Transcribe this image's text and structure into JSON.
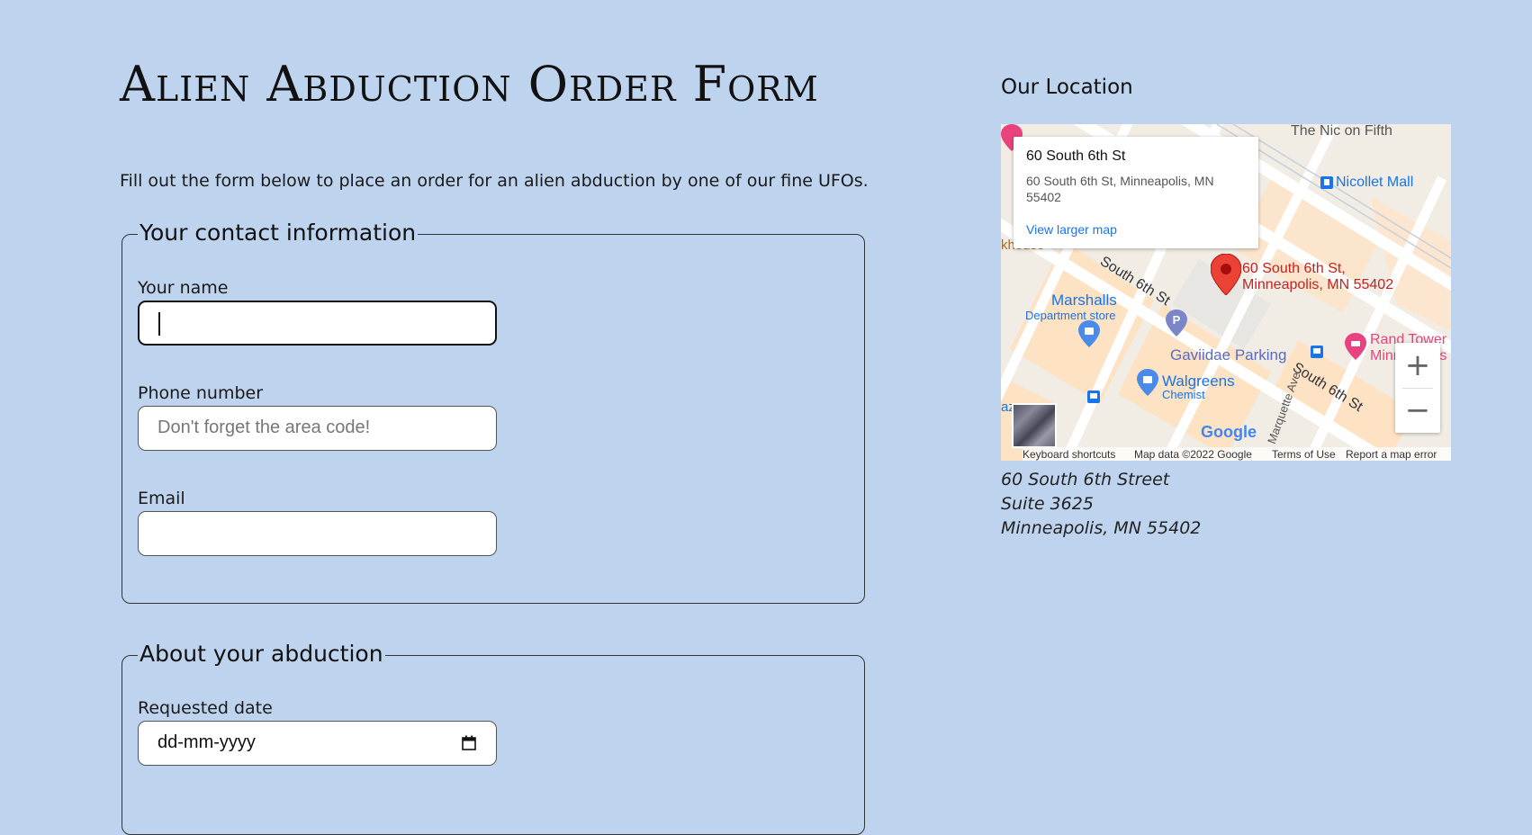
{
  "page": {
    "title": "Alien Abduction Order Form",
    "intro": "Fill out the form below to place an order for an alien abduction by one of our fine UFOs."
  },
  "contact": {
    "legend": "Your contact information",
    "name_label": "Your name",
    "name_value": "",
    "phone_label": "Phone number",
    "phone_placeholder": "Don't forget the area code!",
    "email_label": "Email",
    "email_value": ""
  },
  "abduction": {
    "legend": "About your abduction",
    "date_label": "Requested date",
    "date_placeholder": "dd-mm-yyyy"
  },
  "location": {
    "heading": "Our Location",
    "address_lines": [
      "60 South 6th Street",
      "Suite 3625",
      "Minneapolis, MN 55402"
    ]
  },
  "map": {
    "card_name": "60 South 6th St",
    "card_address": "60 South 6th St, Minneapolis, MN 55402",
    "card_link": "View larger map",
    "marker_label_1": "60 South 6th St,",
    "marker_label_2": "Minneapolis, MN 55402",
    "labels": {
      "nic": "The Nic on Fifth",
      "nicollet": "Nicollet Mall",
      "khouse": "khouse",
      "south6_a": "South 6th St",
      "south6_b": "South 6th St",
      "marshalls": "Marshalls",
      "marshalls_sub": "Department store",
      "gaviidae": "Gaviidae Parking",
      "walgreens": "Walgreens",
      "walgreens_sub": "Chemist",
      "rand1": "Rand Tower",
      "rand2": "Minneapolis",
      "marquette": "Marquette Ave",
      "az": "az",
      "google": "Google"
    },
    "zoom_in": "+",
    "zoom_out": "−",
    "footer": {
      "shortcuts": "Keyboard shortcuts",
      "data": "Map data ©2022 Google",
      "terms": "Terms of Use",
      "report": "Report a map error"
    }
  },
  "colors": {
    "background": "#bed3ee",
    "marker": "#ea4335",
    "link": "#1a73e8",
    "poi_blue": "#1a73e8",
    "poi_pink": "#e8437f"
  }
}
